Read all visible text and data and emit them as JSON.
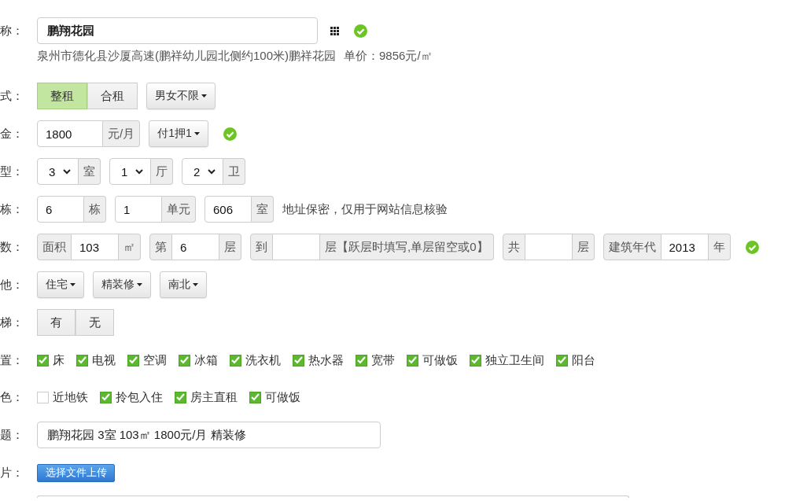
{
  "form": {
    "rows": [
      {
        "kind": "name",
        "label": "称：",
        "controls": [
          {
            "kind": "name_field",
            "value": "鹏翔花园"
          },
          {
            "kind": "grid_icon"
          },
          {
            "kind": "ok_mark"
          }
        ],
        "details": [
          "泉州市德化县沙厦高速(鹏祥幼儿园北侧约100米)鹏祥花园",
          "单价：9856元/㎡"
        ]
      },
      {
        "kind": "mode",
        "label": "式：",
        "controls": [
          {
            "kind": "segmented",
            "options": [
              {
                "label": "整租",
                "selected": true
              },
              {
                "label": "合租",
                "selected": false
              }
            ]
          },
          {
            "kind": "dropdown",
            "label": "男女不限"
          }
        ]
      },
      {
        "kind": "rent",
        "label": "金：",
        "controls": [
          {
            "kind": "input_group",
            "value": "1800",
            "suffix": "元/月"
          },
          {
            "kind": "dropdown",
            "label": "付1押1"
          },
          {
            "kind": "ok_mark"
          }
        ]
      },
      {
        "kind": "layout",
        "label": "型：",
        "controls": [
          {
            "kind": "select_group",
            "value": "3",
            "suffix": "室"
          },
          {
            "kind": "select_group",
            "value": "1",
            "suffix": "厅"
          },
          {
            "kind": "select_group",
            "value": "2",
            "suffix": "卫"
          }
        ]
      },
      {
        "kind": "building",
        "label": "栋：",
        "controls": [
          {
            "kind": "input_group",
            "value": "6",
            "suffix": "栋"
          },
          {
            "kind": "input_group",
            "value": "1",
            "suffix": "单元"
          },
          {
            "kind": "input_group",
            "value": "606",
            "suffix": "室"
          },
          {
            "kind": "note",
            "text": "地址保密，仅用于网站信息核验"
          }
        ]
      },
      {
        "kind": "figures",
        "label": "数：",
        "controls": [
          {
            "kind": "input_group",
            "prefix": "面积",
            "value": "103",
            "suffix": "㎡"
          },
          {
            "kind": "input_group",
            "prefix": "第",
            "value": "6",
            "suffix": "层"
          },
          {
            "kind": "input_group",
            "prefix": "到",
            "suffix": "层【跃层时填写,单层留空或0】"
          },
          {
            "kind": "input_group",
            "prefix": "共",
            "suffix": "层"
          },
          {
            "kind": "input_group",
            "prefix": "建筑年代",
            "value": "2013",
            "suffix": "年"
          },
          {
            "kind": "ok_mark"
          }
        ]
      },
      {
        "kind": "other",
        "label": "他：",
        "controls": [
          {
            "kind": "dropdown",
            "label": "住宅"
          },
          {
            "kind": "dropdown",
            "label": "精装修"
          },
          {
            "kind": "dropdown",
            "label": "南北"
          }
        ]
      },
      {
        "kind": "elevator",
        "label": "梯：",
        "controls": [
          {
            "kind": "segmented",
            "options": [
              {
                "label": "有",
                "selected": false
              },
              {
                "label": "无",
                "selected": false
              }
            ]
          }
        ]
      },
      {
        "kind": "facilities",
        "label": "置：",
        "controls": [
          {
            "kind": "checkbox",
            "label": "床",
            "checked": true
          },
          {
            "kind": "checkbox",
            "label": "电视",
            "checked": true
          },
          {
            "kind": "checkbox",
            "label": "空调",
            "checked": true
          },
          {
            "kind": "checkbox",
            "label": "冰箱",
            "checked": true
          },
          {
            "kind": "checkbox",
            "label": "洗衣机",
            "checked": true
          },
          {
            "kind": "checkbox",
            "label": "热水器",
            "checked": true
          },
          {
            "kind": "checkbox",
            "label": "宽带",
            "checked": true
          },
          {
            "kind": "checkbox",
            "label": "可做饭",
            "checked": true
          },
          {
            "kind": "checkbox",
            "label": "独立卫生间",
            "checked": true
          },
          {
            "kind": "checkbox",
            "label": "阳台",
            "checked": true
          }
        ]
      },
      {
        "kind": "features",
        "label": "色：",
        "controls": [
          {
            "kind": "checkbox",
            "label": "近地铁",
            "checked": false
          },
          {
            "kind": "checkbox",
            "label": "拎包入住",
            "checked": true
          },
          {
            "kind": "checkbox",
            "label": "房主直租",
            "checked": true
          },
          {
            "kind": "checkbox",
            "label": "可做饭",
            "checked": true
          }
        ]
      },
      {
        "kind": "title",
        "label": "题：",
        "controls": [
          {
            "kind": "title_field",
            "value": "鹏翔花园 3室 103㎡ 1800元/月 精装修"
          }
        ]
      },
      {
        "kind": "photos",
        "label": "片：",
        "controls": [
          {
            "kind": "upload_button",
            "label": "选择文件上传"
          }
        ]
      },
      {
        "kind": "more",
        "controls": [
          {
            "kind": "blank_field"
          }
        ]
      }
    ]
  }
}
